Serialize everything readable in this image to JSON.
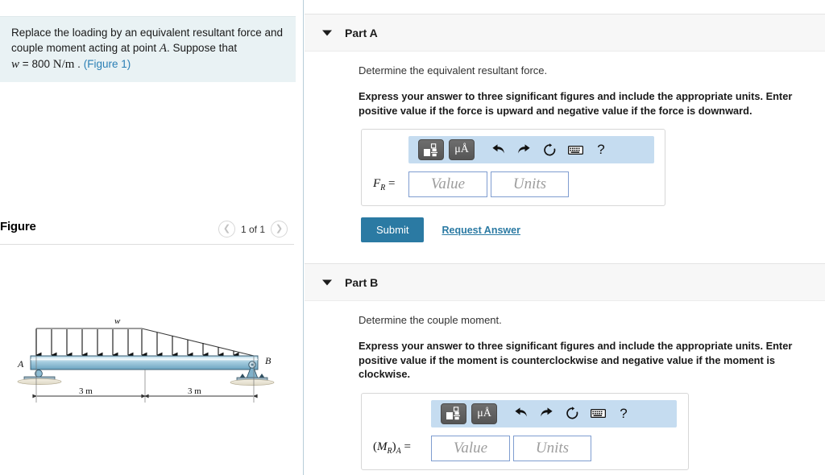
{
  "left": {
    "question": {
      "line1_a": "Replace the loading by an equivalent resultant force and",
      "line2_a": "couple moment acting at point ",
      "point_symbol": "A",
      "line2_b": ". Suppose that",
      "w_symbol": "w",
      "equals": "=",
      "w_value": "800",
      "w_units": "N/m",
      "period": ".",
      "figure_link": "(Figure 1)"
    },
    "figure": {
      "title": "Figure",
      "prev_icon": "chevron-left-icon",
      "next_icon": "chevron-right-icon",
      "page_label": "1 of 1",
      "diagram": {
        "load_label": "w",
        "support_a_label": "A",
        "support_b_label": "B",
        "dim_left": "3 m",
        "dim_right": "3 m",
        "beam_color": "#7fb4cc",
        "beam_highlight": "#d9eaf2",
        "outline_color": "#222222"
      }
    }
  },
  "right": {
    "parts": [
      {
        "caret_icon": "caret-down-icon",
        "title": "Part A",
        "prompt": "Determine the equivalent resultant force.",
        "instruction": "Express your answer to three significant figures and include the appropriate units. Enter positive value if the force is upward and negative value if the force is downward.",
        "toolbar": {
          "template_button": "template-icon",
          "units_button": "μÅ",
          "undo_icon": "undo-arrow-icon",
          "redo_icon": "redo-arrow-icon",
          "reset_icon": "reset-circular-arrow-icon",
          "keyboard_icon": "keyboard-icon",
          "help_icon": "?"
        },
        "entry": {
          "label_main": "F",
          "label_sub": "R",
          "label_eq": "=",
          "value_placeholder": "Value",
          "units_placeholder": "Units",
          "value_text": "",
          "units_text": ""
        },
        "actions": {
          "submit_label": "Submit",
          "request_label": "Request Answer"
        }
      },
      {
        "caret_icon": "caret-down-icon",
        "title": "Part B",
        "prompt": "Determine the couple moment.",
        "instruction": "Express your answer to three significant figures and include the appropriate units. Enter positive value if the moment is counterclockwise and negative value if the moment is clockwise.",
        "toolbar": {
          "template_button": "template-icon",
          "units_button": "μÅ",
          "undo_icon": "undo-arrow-icon",
          "redo_icon": "redo-arrow-icon",
          "reset_icon": "reset-circular-arrow-icon",
          "keyboard_icon": "keyboard-icon",
          "help_icon": "?"
        },
        "entry": {
          "label_open": "(",
          "label_main": "M",
          "label_sub": "R",
          "label_close": ")",
          "label_sub2": "A",
          "label_eq": "=",
          "value_placeholder": "Value",
          "units_placeholder": "Units",
          "value_text": "",
          "units_text": ""
        }
      }
    ]
  },
  "colors": {
    "accent": "#2b7aa3",
    "question_bg": "#e9f2f4",
    "toolbar_bg": "#c5dcf0",
    "part_header_bg": "#f7f7f7",
    "input_border": "#7f9dd0"
  }
}
